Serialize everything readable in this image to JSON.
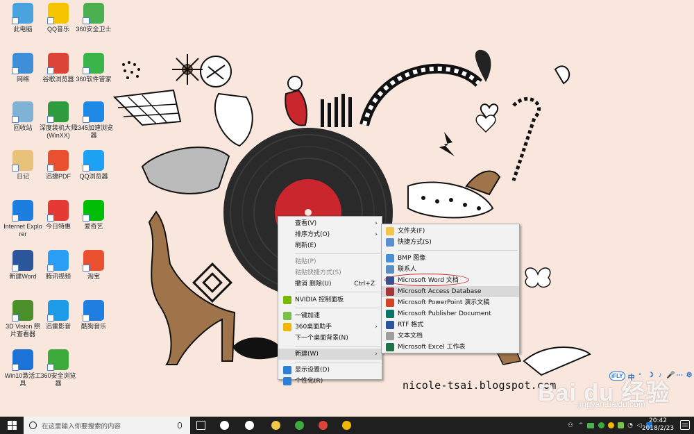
{
  "desktop_icons": [
    {
      "label": "此电脑",
      "icon": "computer-icon",
      "color": "#4aa3df"
    },
    {
      "label": "QQ音乐",
      "icon": "qq-music-icon",
      "color": "#f5c400"
    },
    {
      "label": "360安全卫士",
      "icon": "360-security-icon",
      "color": "#4caf50"
    },
    {
      "label": "网络",
      "icon": "network-icon",
      "color": "#3f8fd8"
    },
    {
      "label": "谷歌浏览器",
      "icon": "chrome-icon",
      "color": "#db4437"
    },
    {
      "label": "360软件管家",
      "icon": "360-software-icon",
      "color": "#39b54a"
    },
    {
      "label": "回收站",
      "icon": "recycle-bin-icon",
      "color": "#7fb3d5"
    },
    {
      "label": "深度装机大师(WinXX)",
      "icon": "deep-install-icon",
      "color": "#2e9b3e"
    },
    {
      "label": "2345加速浏览器",
      "icon": "2345-browser-icon",
      "color": "#1e88e5"
    },
    {
      "label": "日记",
      "icon": "diary-icon",
      "color": "#e8c27a"
    },
    {
      "label": "迅捷PDF",
      "icon": "pdf-icon",
      "color": "#e8502f"
    },
    {
      "label": "QQ浏览器",
      "icon": "qq-browser-icon",
      "color": "#1da1f2"
    },
    {
      "label": "Internet Explorer",
      "icon": "ie-icon",
      "color": "#1b7ee0"
    },
    {
      "label": "今日特惠",
      "icon": "coupon-icon",
      "color": "#e53935"
    },
    {
      "label": "爱奇艺",
      "icon": "iqiyi-icon",
      "color": "#00be06"
    },
    {
      "label": "新建Word",
      "icon": "word-doc-icon",
      "color": "#2b579a"
    },
    {
      "label": "腾讯视频",
      "icon": "tencent-video-icon",
      "color": "#2a9df4"
    },
    {
      "label": "淘宝",
      "icon": "taobao-icon",
      "color": "#e8502f"
    },
    {
      "label": "3D Vision 照片查看器",
      "icon": "3d-vision-icon",
      "color": "#4b8f2b"
    },
    {
      "label": "迅雷影音",
      "icon": "xunlei-video-icon",
      "color": "#1e9be6"
    },
    {
      "label": "酷狗音乐",
      "icon": "kugou-icon",
      "color": "#1e7fe0"
    },
    {
      "label": "Win10激活工具",
      "icon": "windows-activate-icon",
      "color": "#1b73d8"
    },
    {
      "label": "360安全浏览器",
      "icon": "360-browser-icon",
      "color": "#3cab3c"
    }
  ],
  "context_menu": {
    "items": [
      {
        "label": "查看(V)",
        "submenu": true
      },
      {
        "label": "排序方式(O)",
        "submenu": true
      },
      {
        "label": "刷新(E)"
      },
      {
        "sep": true
      },
      {
        "label": "粘贴(P)",
        "disabled": true
      },
      {
        "label": "粘贴快捷方式(S)",
        "disabled": true
      },
      {
        "label": "撤消 删除(U)",
        "accel": "Ctrl+Z"
      },
      {
        "sep": true
      },
      {
        "label": "NVIDIA 控制面板",
        "icon": "nvidia-icon",
        "color": "#76b900"
      },
      {
        "sep": true
      },
      {
        "label": "一键加速",
        "icon": "speedup-icon",
        "color": "#7cc04b"
      },
      {
        "label": "360桌面助手",
        "icon": "360-desktop-icon",
        "color": "#f2b705",
        "submenu": true
      },
      {
        "label": "下一个桌面背景(N)"
      },
      {
        "sep": true
      },
      {
        "label": "新建(W)",
        "submenu": true,
        "highlight": true
      },
      {
        "sep": true
      },
      {
        "label": "显示设置(D)",
        "icon": "display-settings-icon",
        "color": "#2d7fd8"
      },
      {
        "label": "个性化(R)",
        "icon": "personalize-icon",
        "color": "#2d7fd8"
      }
    ]
  },
  "new_submenu": {
    "items": [
      {
        "label": "文件夹(F)",
        "icon": "folder-icon",
        "color": "#f3c64a"
      },
      {
        "label": "快捷方式(S)",
        "icon": "shortcut-icon",
        "color": "#5b8fd0"
      },
      {
        "sep": true
      },
      {
        "label": "BMP 图像",
        "icon": "bmp-image-icon",
        "color": "#4a90d9"
      },
      {
        "label": "联系人",
        "icon": "contact-icon",
        "color": "#5a8ec2"
      },
      {
        "label": "Microsoft Word 文档",
        "icon": "word-icon",
        "color": "#2b579a"
      },
      {
        "label": "Microsoft Access Database",
        "icon": "access-icon",
        "color": "#a4373a",
        "highlight": true
      },
      {
        "label": "Microsoft PowerPoint 演示文稿",
        "icon": "powerpoint-icon",
        "color": "#d04526"
      },
      {
        "label": "Microsoft Publisher Document",
        "icon": "publisher-icon",
        "color": "#077568"
      },
      {
        "label": "RTF 格式",
        "icon": "rtf-icon",
        "color": "#2b579a"
      },
      {
        "label": "文本文档",
        "icon": "text-doc-icon",
        "color": "#9e9e9e"
      },
      {
        "label": "Microsoft Excel 工作表",
        "icon": "excel-icon",
        "color": "#217346"
      }
    ]
  },
  "watermark": {
    "url": "nicole-tsai.blogspot.com",
    "baidu": "Bai du 经验",
    "baidu_sub": "jingyan.baidu.com"
  },
  "ifly_toolbar": {
    "badge": "iFLY",
    "buttons": [
      "中",
      "⠂",
      "☽",
      "♪",
      "🎤",
      "⋯",
      "⚙"
    ]
  },
  "taskbar": {
    "search_placeholder": "在这里输入你要搜索的内容",
    "pinned": [
      {
        "name": "task-view-icon",
        "color": "#ffffff"
      },
      {
        "name": "fan-app-icon",
        "color": "#ffffff"
      },
      {
        "name": "edge-icon",
        "color": "#ffffff"
      },
      {
        "name": "file-explorer-icon",
        "color": "#f3c64a"
      },
      {
        "name": "360-browser-icon",
        "color": "#3cab3c"
      },
      {
        "name": "chrome-icon",
        "color": "#db4437"
      },
      {
        "name": "360-game-icon",
        "color": "#f2b705"
      }
    ],
    "clock_time": "20:42",
    "clock_date": "2018/2/23"
  }
}
